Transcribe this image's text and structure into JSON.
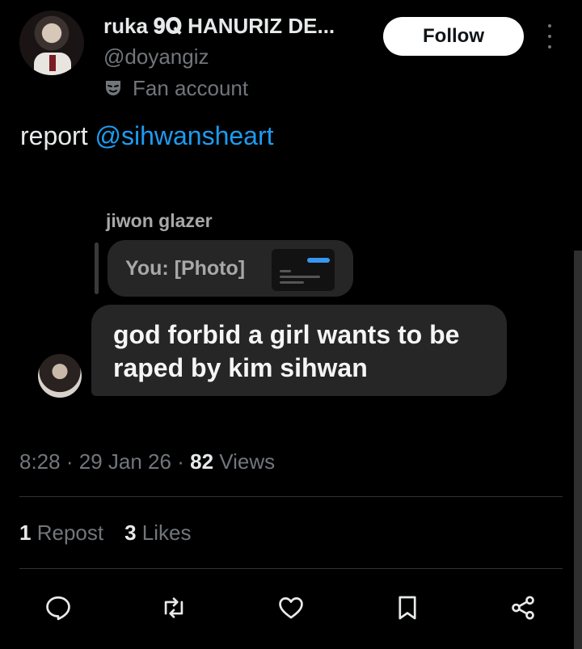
{
  "author": {
    "display_name": "ruka 𝟗𝐐 HANURIZ DE...",
    "handle": "@doyangiz",
    "badge_icon": "fan-mask-icon",
    "badge_label": "Fan account"
  },
  "follow_label": "Follow",
  "post": {
    "text": "report",
    "mention": "@sihwansheart"
  },
  "embedded_dm": {
    "reply_to_name": "jiwon glazer",
    "reply_preview": "You: [Photo]",
    "message": "god forbid a girl wants to be raped by kim sihwan"
  },
  "meta": {
    "time": "8:28",
    "date": "29 Jan 26",
    "views_count": "82",
    "views_label": "Views",
    "separator": "·"
  },
  "stats": {
    "reposts_count": "1",
    "reposts_label": "Repost",
    "likes_count": "3",
    "likes_label": "Likes"
  },
  "actions": [
    "reply-icon",
    "repost-icon",
    "like-icon",
    "bookmark-icon",
    "share-icon"
  ],
  "colors": {
    "background": "#000000",
    "mention": "#1d9bf0",
    "secondary_text": "#71767b",
    "bubble": "#262626"
  }
}
